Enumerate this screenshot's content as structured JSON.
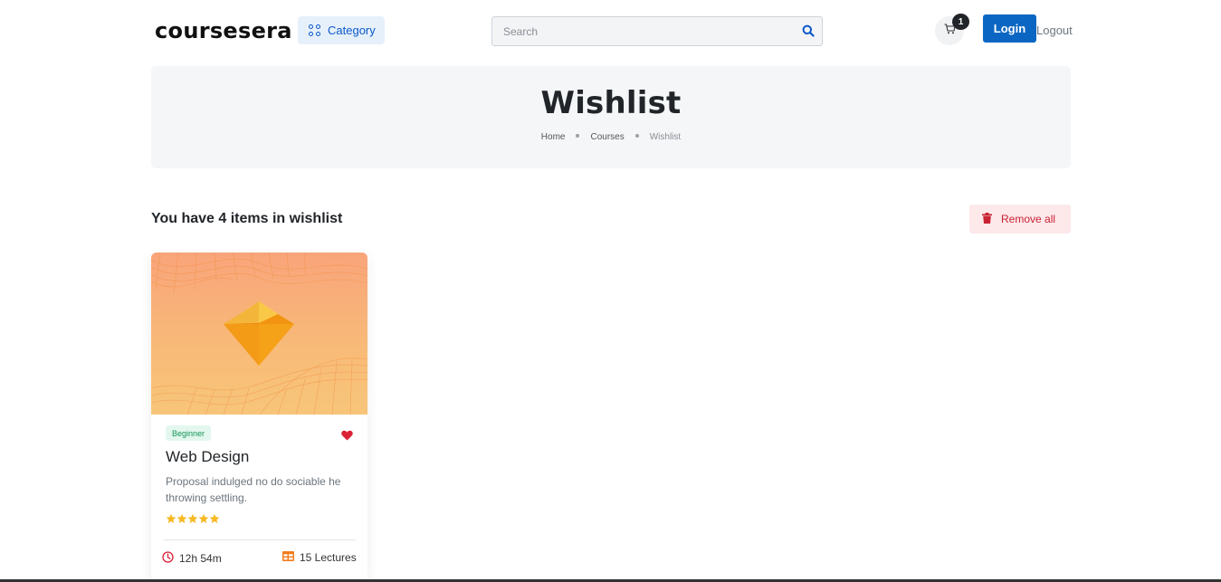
{
  "header": {
    "logo": "coursesera",
    "category_label": "Category",
    "search_placeholder": "Search",
    "cart_count": "1",
    "login_label": "Login",
    "logout_label": "Logout"
  },
  "hero": {
    "title": "Wishlist",
    "breadcrumb": [
      "Home",
      "Courses",
      "Wishlist"
    ]
  },
  "wishlist": {
    "heading": "You have 4 items in wishlist",
    "remove_all_label": "Remove all"
  },
  "courses": [
    {
      "level": "Beginner",
      "title": "Web Design",
      "description": "Proposal indulged no do sociable he throwing settling.",
      "rating": 5,
      "duration": "12h 54m",
      "lectures": "15 Lectures",
      "favorited": true
    }
  ],
  "colors": {
    "primary": "#0a66c2",
    "danger": "#c82333",
    "success": "#16955a",
    "star": "#f7b924",
    "lectures_icon": "#f27c1b"
  }
}
